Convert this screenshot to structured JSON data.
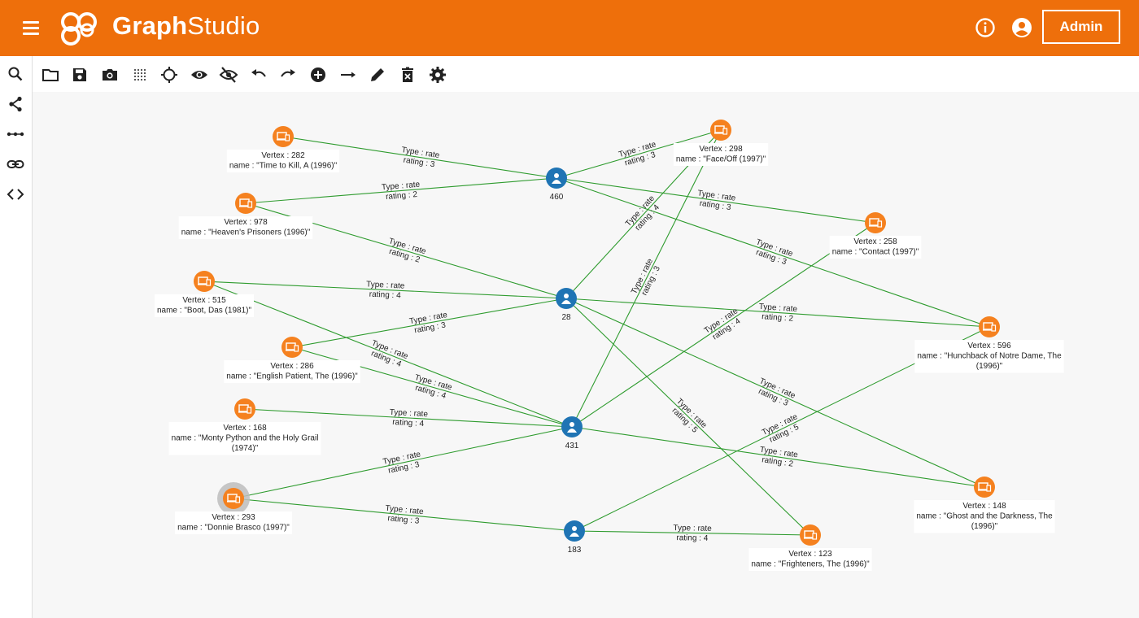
{
  "app": {
    "brand_bold": "Graph",
    "brand_light": "Studio",
    "admin_label": "Admin"
  },
  "icons": {
    "menu": "menu-icon",
    "logo": "graphstudio-logo",
    "info": "info-icon",
    "account": "account-circle-icon",
    "sidebar": [
      "search-icon",
      "share-icon",
      "dotted-line-icon",
      "link-icon",
      "code-icon"
    ],
    "toolbar": [
      "folder-icon",
      "save-icon",
      "camera-icon",
      "grid-icon",
      "locate-icon",
      "eye-icon",
      "eye-off-icon",
      "undo-icon",
      "redo-icon",
      "add-circle-icon",
      "arrow-right-icon",
      "pencil-icon",
      "delete-icon",
      "settings-icon"
    ]
  },
  "colors": {
    "topbar": "#ee6f0b",
    "movie_vertex": "#f5811f",
    "user_vertex": "#1f74b4",
    "edge": "#2e9b2e",
    "canvas": "#f7f7f7",
    "selection_halo": "#bdbdbd"
  },
  "graph": {
    "user_vertices": [
      {
        "id": "460"
      },
      {
        "id": "28"
      },
      {
        "id": "431"
      },
      {
        "id": "183"
      }
    ],
    "movie_vertices": [
      {
        "id": "282",
        "line1": "Vertex : 282",
        "line2": "name : \"Time to Kill, A (1996)\"",
        "line3": ""
      },
      {
        "id": "298",
        "line1": "Vertex : 298",
        "line2": "name : \"Face/Off (1997)\"",
        "line3": ""
      },
      {
        "id": "978",
        "line1": "Vertex : 978",
        "line2": "name : \"Heaven's Prisoners (1996)\"",
        "line3": ""
      },
      {
        "id": "258",
        "line1": "Vertex : 258",
        "line2": "name : \"Contact (1997)\"",
        "line3": ""
      },
      {
        "id": "515",
        "line1": "Vertex : 515",
        "line2": "name : \"Boot, Das (1981)\"",
        "line3": ""
      },
      {
        "id": "596",
        "line1": "Vertex : 596",
        "line2": "name : \"Hunchback of Notre Dame, The",
        "line3": "(1996)\""
      },
      {
        "id": "286",
        "line1": "Vertex : 286",
        "line2": "name : \"English Patient, The (1996)\"",
        "line3": ""
      },
      {
        "id": "168",
        "line1": "Vertex : 168",
        "line2": "name : \"Monty Python and the Holy Grail",
        "line3": "(1974)\""
      },
      {
        "id": "293",
        "line1": "Vertex : 293",
        "line2": "name : \"Donnie Brasco (1997)\"",
        "line3": "",
        "selected": true
      },
      {
        "id": "148",
        "line1": "Vertex : 148",
        "line2": "name : \"Ghost and the Darkness, The",
        "line3": "(1996)\""
      },
      {
        "id": "123",
        "line1": "Vertex : 123",
        "line2": "name : \"Frighteners, The (1996)\"",
        "line3": ""
      }
    ],
    "edges": [
      {
        "from": "282",
        "to": "460",
        "type": "Type : rate",
        "rating": "rating : 3"
      },
      {
        "from": "978",
        "to": "460",
        "type": "Type : rate",
        "rating": "rating : 2"
      },
      {
        "from": "460",
        "to": "298",
        "type": "Type : rate",
        "rating": "rating : 3"
      },
      {
        "from": "460",
        "to": "258",
        "type": "Type : rate",
        "rating": "rating : 3"
      },
      {
        "from": "460",
        "to": "596",
        "type": "Type : rate",
        "rating": "rating : 3"
      },
      {
        "from": "978",
        "to": "28",
        "type": "Type : rate",
        "rating": "rating : 2"
      },
      {
        "from": "515",
        "to": "28",
        "type": "Type : rate",
        "rating": "rating : 4"
      },
      {
        "from": "286",
        "to": "28",
        "type": "Type : rate",
        "rating": "rating : 3"
      },
      {
        "from": "28",
        "to": "298",
        "type": "Type : rate",
        "rating": "rating : 4"
      },
      {
        "from": "28",
        "to": "596",
        "type": "Type : rate",
        "rating": "rating : 2"
      },
      {
        "from": "28",
        "to": "148",
        "type": "Type : rate",
        "rating": "rating : 3"
      },
      {
        "from": "28",
        "to": "123",
        "type": "Type : rate",
        "rating": "rating : 5"
      },
      {
        "from": "515",
        "to": "431",
        "type": "Type : rate",
        "rating": "rating : 4"
      },
      {
        "from": "286",
        "to": "431",
        "type": "Type : rate",
        "rating": "rating : 4"
      },
      {
        "from": "168",
        "to": "431",
        "type": "Type : rate",
        "rating": "rating : 4"
      },
      {
        "from": "293",
        "to": "431",
        "type": "Type : rate",
        "rating": "rating : 3"
      },
      {
        "from": "431",
        "to": "298",
        "type": "Type : rate",
        "rating": "rating : 3"
      },
      {
        "from": "431",
        "to": "258",
        "type": "Type : rate",
        "rating": "rating : 4"
      },
      {
        "from": "431",
        "to": "148",
        "type": "Type : rate",
        "rating": "rating : 2"
      },
      {
        "from": "293",
        "to": "183",
        "type": "Type : rate",
        "rating": "rating : 3"
      },
      {
        "from": "183",
        "to": "123",
        "type": "Type : rate",
        "rating": "rating : 4"
      },
      {
        "from": "183",
        "to": "596",
        "type": "Type : rate",
        "rating": "rating : 5"
      }
    ]
  }
}
